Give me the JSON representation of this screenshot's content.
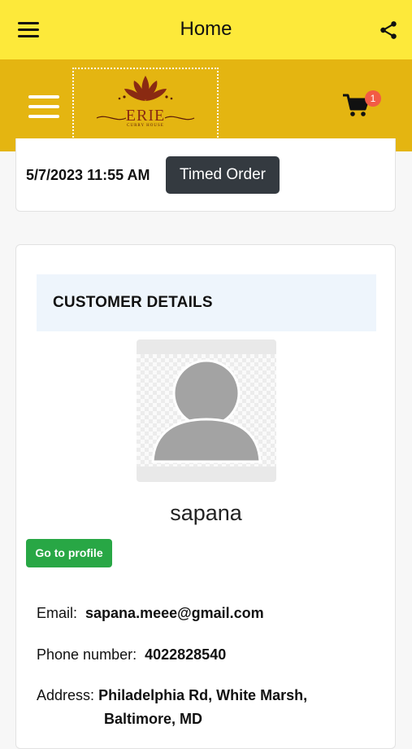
{
  "header": {
    "title": "Home",
    "menu_icon": "hamburger-menu-icon",
    "share_icon": "share-icon",
    "bg_color": "#fde93a"
  },
  "brand": {
    "logo_text": "ERIE",
    "logo_subtext": "CURRY HOUSE",
    "bg_color": "#e4b511",
    "cart_count": "1"
  },
  "order": {
    "datetime": "5/7/2023 11:55 AM",
    "type_label": "Timed Order"
  },
  "customer": {
    "section_title": "CUSTOMER DETAILS",
    "name": "sapana",
    "profile_button": "Go to profile",
    "email_label": "Email:",
    "email": "sapana.meee@gmail.com",
    "phone_label": "Phone number:",
    "phone": "4022828540",
    "address_label": "Address:",
    "address_line1": "Philadelphia Rd, White Marsh,",
    "address_line2": "Baltimore, MD"
  }
}
